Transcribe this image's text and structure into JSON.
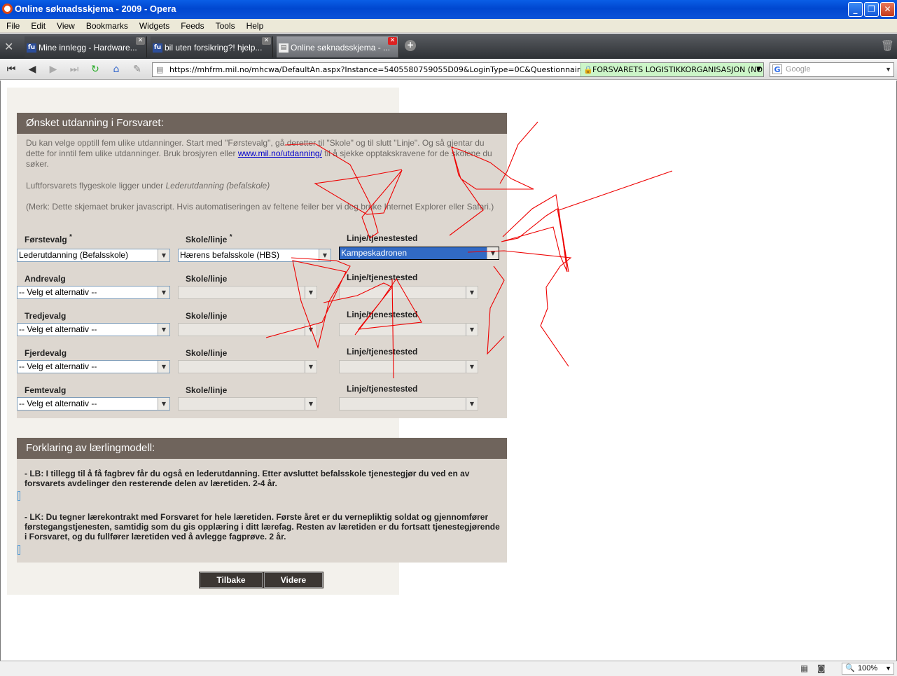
{
  "window": {
    "title": "Online søknadsskjema - 2009 - Opera",
    "minimize": "_",
    "maximize": "❐",
    "close": "✕"
  },
  "menu": [
    "File",
    "Edit",
    "View",
    "Bookmarks",
    "Widgets",
    "Feeds",
    "Tools",
    "Help"
  ],
  "tabs": [
    {
      "label": "Mine innlegg - Hardware...",
      "icon": "fu"
    },
    {
      "label": "bil uten forsikring?! hjelp...",
      "icon": "fu"
    },
    {
      "label": "Online søknadsskjema - ...",
      "icon": "page"
    }
  ],
  "address": {
    "url": "https://mhfrm.mil.no/mhcwa/DefaultAn.aspx?Instance=5405580759055D09&LoginType=0C&QuestionnaireID=0B5D0F58",
    "security_label": "FORSVARETS LOGISTIKKORGANISASJON (NO)",
    "search_placeholder": "Google"
  },
  "form": {
    "heading": "Ønsket utdanning i Forsvaret:",
    "intro_line1_pre": "Du kan velge opptill fem ulike utdanninger. Start med \"Førstevalg\", gå deretter til \"Skole\" og til slutt \"Linje\". Og så gjentar du dette for inntil fem ulike utdanninger. Bruk brosjyren eller ",
    "intro_link": "www.mil.no/utdanning/",
    "intro_line1_post": " til å sjekke opptakskravene for de skolene du søker.",
    "intro_line2_pre": "Luftforsvarets flygeskole ligger under ",
    "intro_line2_em": "Lederutdanning (befalskole)",
    "intro_line3": "(Merk: Dette skjemaet bruker javascript. Hvis automatiseringen av feltene feiler ber vi deg bruke Internet Explorer eller Safari.)",
    "rows": [
      {
        "choice_label": "Førstevalg",
        "required": "*",
        "school_label": "Skole/linje",
        "school_required": "*",
        "line_label": "Linje/tjenestested",
        "choice_value": "Lederutdanning (Befalsskole)",
        "school_value": "Hærens befalsskole (HBS)",
        "line_value": "Kampeskadronen"
      },
      {
        "choice_label": "Andrevalg",
        "required": "",
        "school_label": "Skole/linje",
        "school_required": "",
        "line_label": "Linje/tjenestested",
        "choice_value": "-- Velg et alternativ --",
        "school_value": "",
        "line_value": ""
      },
      {
        "choice_label": "Tredjevalg",
        "required": "",
        "school_label": "Skole/linje",
        "school_required": "",
        "line_label": "Linje/tjenestested",
        "choice_value": "-- Velg et alternativ --",
        "school_value": "",
        "line_value": ""
      },
      {
        "choice_label": "Fjerdevalg",
        "required": "",
        "school_label": "Skole/linje",
        "school_required": "",
        "line_label": "Linje/tjenestested",
        "choice_value": "-- Velg et alternativ --",
        "school_value": "",
        "line_value": ""
      },
      {
        "choice_label": "Femtevalg",
        "required": "",
        "school_label": "Skole/linje",
        "school_required": "",
        "line_label": "Linje/tjenestested",
        "choice_value": "-- Velg et alternativ --",
        "school_value": "",
        "line_value": ""
      }
    ]
  },
  "explanation": {
    "heading": "Forklaring av lærlingmodell:",
    "lb": "- LB: I tillegg til å få fagbrev får du også en lederutdanning. Etter avsluttet befalsskole tjenestegjør du ved en av forsvarets avdelinger den resterende delen av læretiden. 2-4 år.",
    "lk": "- LK: Du tegner lærekontrakt med Forsvaret for hele læretiden. Første året er du vernepliktig soldat og gjennomfører førstegangstjenesten, samtidig som du gis opplæring i ditt lærefag. Resten av læretiden er du fortsatt tjenestegjørende i Forsvaret, og du fullfører læretiden ved å avlegge fagprøve. 2 år."
  },
  "buttons": {
    "back": "Tilbake",
    "next": "Videre"
  },
  "status": {
    "zoom": "100%"
  }
}
